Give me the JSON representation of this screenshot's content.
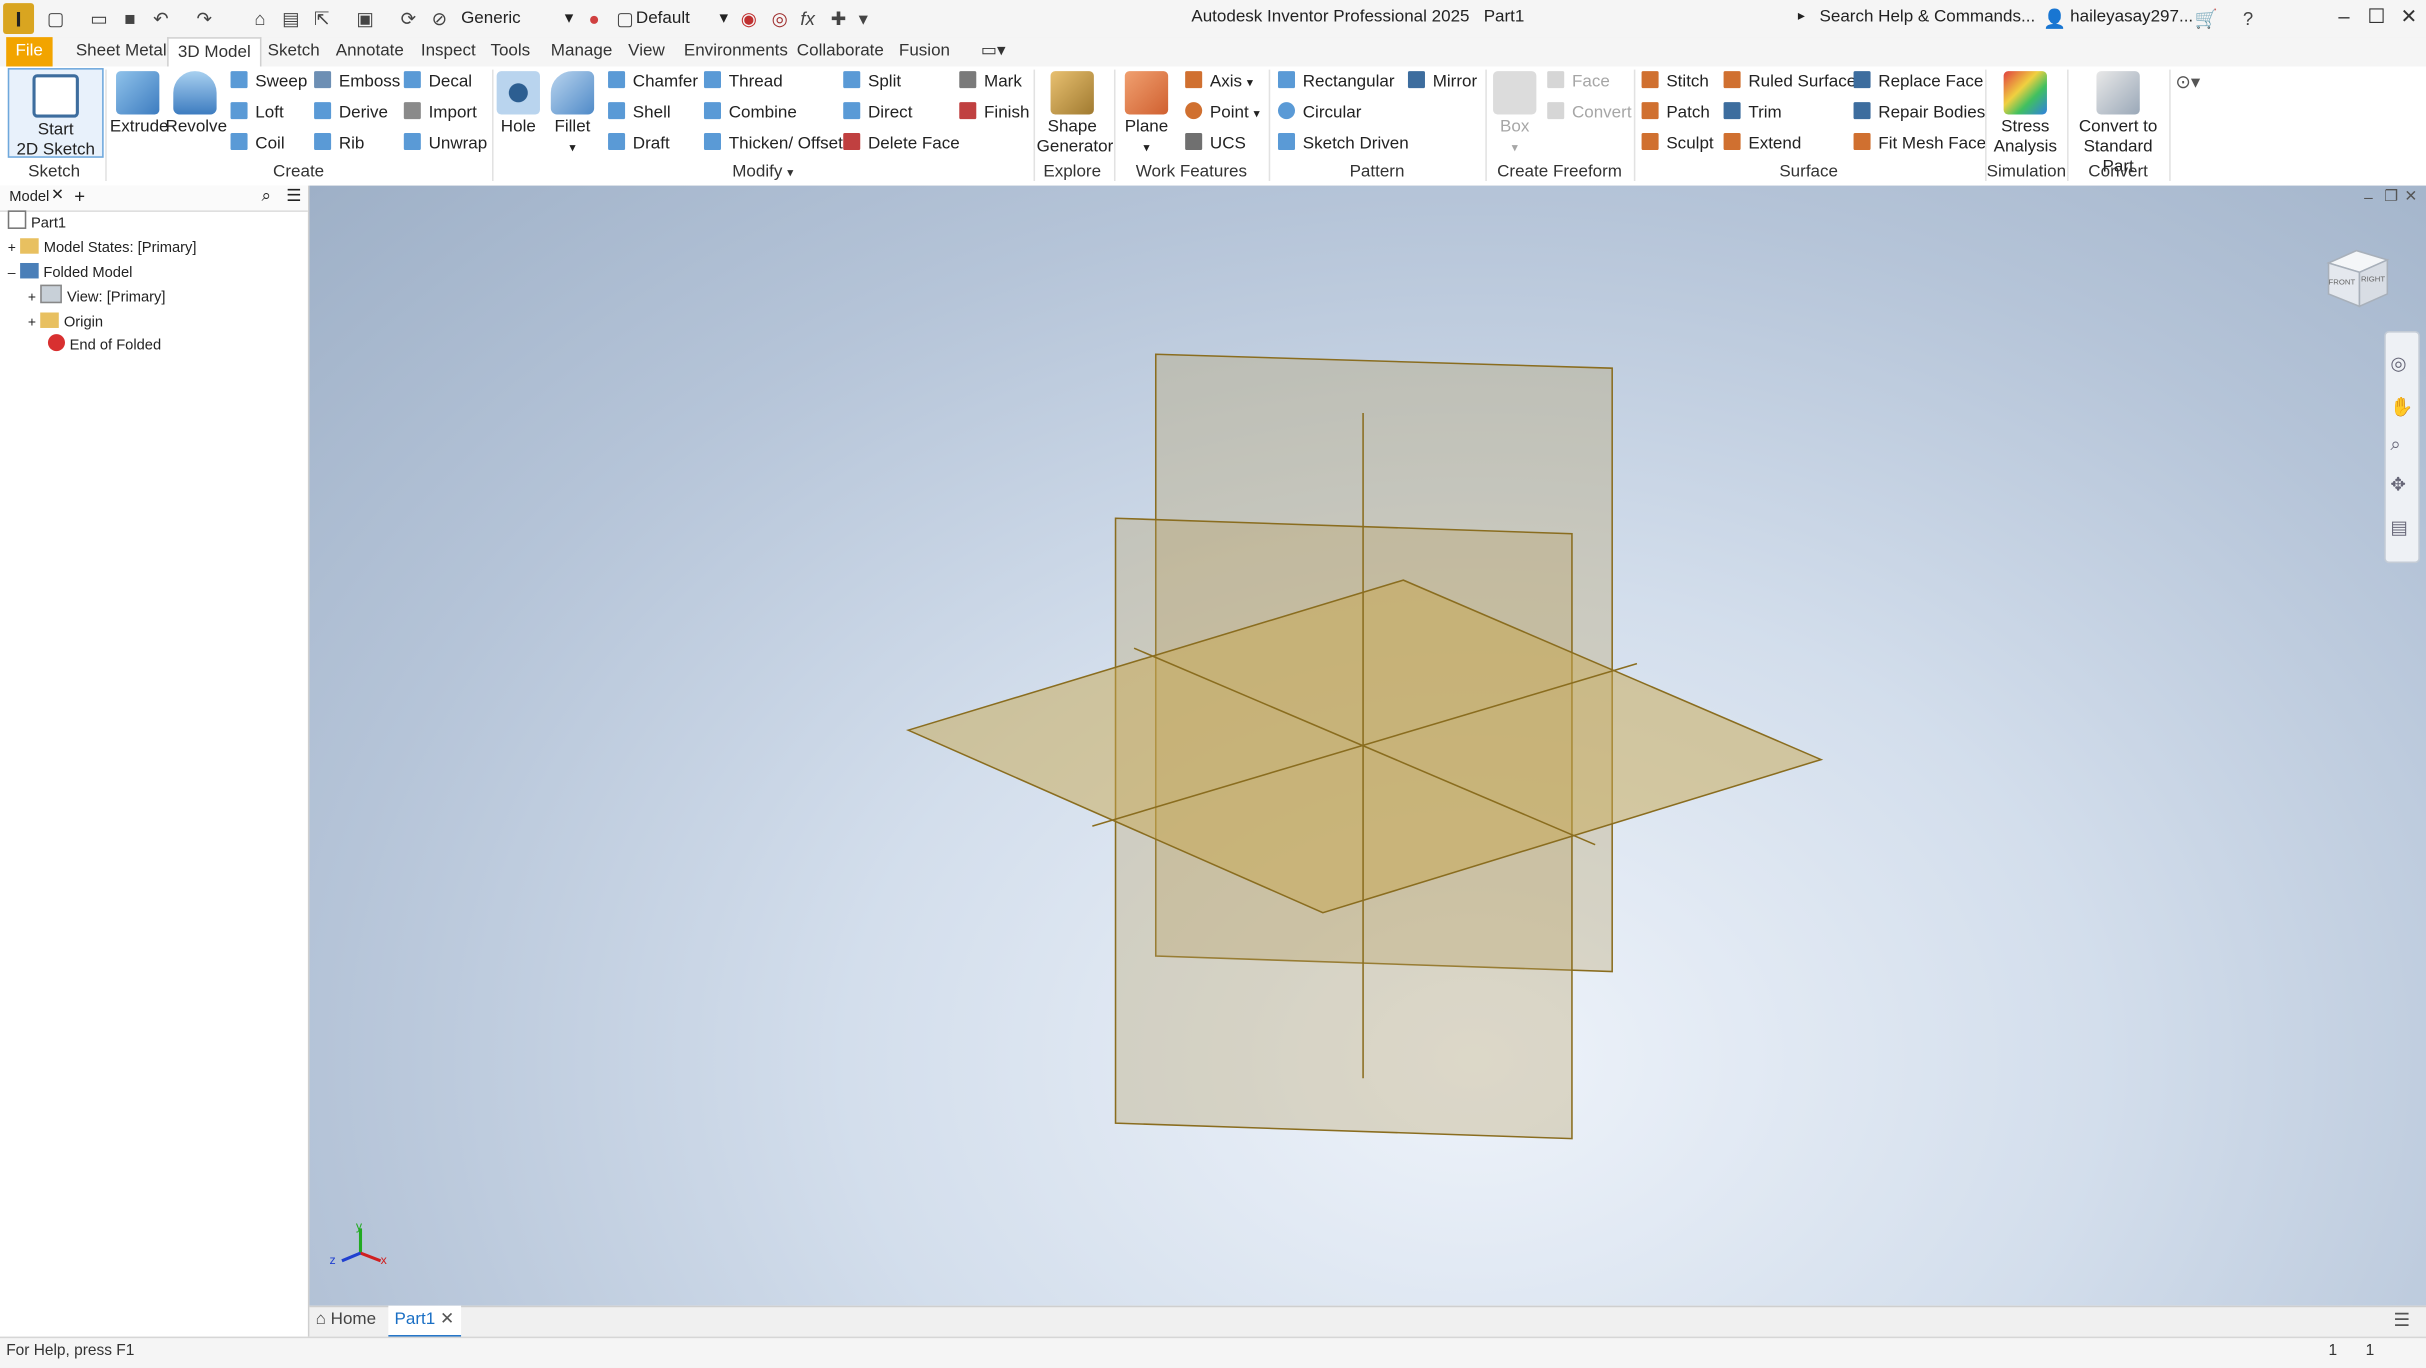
{
  "app": {
    "title": "Autodesk Inventor Professional 2025",
    "document": "Part1",
    "logo_letter": "I"
  },
  "quick_access": {
    "material": "Generic",
    "appearance": "Default",
    "fx": "fx"
  },
  "search": {
    "placeholder": "Search Help & Commands..."
  },
  "user": {
    "name": "haileyasay297..."
  },
  "tabs": [
    "File",
    "Sheet Metal",
    "3D Model",
    "Sketch",
    "Annotate",
    "Inspect",
    "Tools",
    "Manage",
    "View",
    "Environments",
    "Collaborate",
    "Fusion"
  ],
  "active_tab": "3D Model",
  "ribbon": {
    "sketch": {
      "start": "Start",
      "start2": "2D Sketch",
      "panel": "Sketch"
    },
    "create": {
      "extrude": "Extrude",
      "revolve": "Revolve",
      "sweep": "Sweep",
      "loft": "Loft",
      "coil": "Coil",
      "emboss": "Emboss",
      "derive": "Derive",
      "rib": "Rib",
      "decal": "Decal",
      "import": "Import",
      "unwrap": "Unwrap",
      "panel": "Create"
    },
    "modify": {
      "hole": "Hole",
      "fillet": "Fillet",
      "chamfer": "Chamfer",
      "shell": "Shell",
      "draft": "Draft",
      "thread": "Thread",
      "combine": "Combine",
      "thicken": "Thicken/ Offset",
      "split": "Split",
      "direct": "Direct",
      "delete_face": "Delete Face",
      "mark": "Mark",
      "finish": "Finish",
      "panel": "Modify"
    },
    "explore": {
      "shape1": "Shape",
      "shape2": "Generator",
      "panel": "Explore"
    },
    "work": {
      "plane": "Plane",
      "axis": "Axis",
      "point": "Point",
      "ucs": "UCS",
      "panel": "Work Features"
    },
    "pattern": {
      "rect": "Rectangular",
      "circ": "Circular",
      "sketch_driven": "Sketch Driven",
      "mirror": "Mirror",
      "panel": "Pattern"
    },
    "freeform": {
      "box": "Box",
      "face": "Face",
      "convert": "Convert",
      "panel": "Create Freeform"
    },
    "surface": {
      "stitch": "Stitch",
      "patch": "Patch",
      "sculpt": "Sculpt",
      "ruled": "Ruled Surface",
      "trim": "Trim",
      "extend": "Extend",
      "replace": "Replace Face",
      "repair": "Repair Bodies",
      "fit_mesh": "Fit Mesh Face",
      "panel": "Surface"
    },
    "simulation": {
      "stress1": "Stress",
      "stress2": "Analysis",
      "panel": "Simulation"
    },
    "convert": {
      "c1": "Convert to",
      "c2": "Standard Part",
      "panel": "Convert"
    }
  },
  "browser": {
    "tab": "Model",
    "items": [
      {
        "label": "Part1"
      },
      {
        "label": "Model States: [Primary]"
      },
      {
        "label": "Folded Model"
      },
      {
        "label": "View: [Primary]"
      },
      {
        "label": "Origin"
      },
      {
        "label": "End of Folded"
      }
    ]
  },
  "viewcube": {
    "front": "FRONT",
    "right": "RIGHT"
  },
  "triad": {
    "x": "x",
    "y": "y",
    "z": "z"
  },
  "doc_tabs": {
    "home": "Home",
    "part": "Part1"
  },
  "status": {
    "help": "For Help, press F1",
    "count1": "1",
    "count2": "1"
  },
  "colors": {
    "file_tab": "#f2a400",
    "plane_fill": "#c8a850",
    "plane_edge": "#8a6d1f",
    "accent": "#1a6fc4"
  }
}
